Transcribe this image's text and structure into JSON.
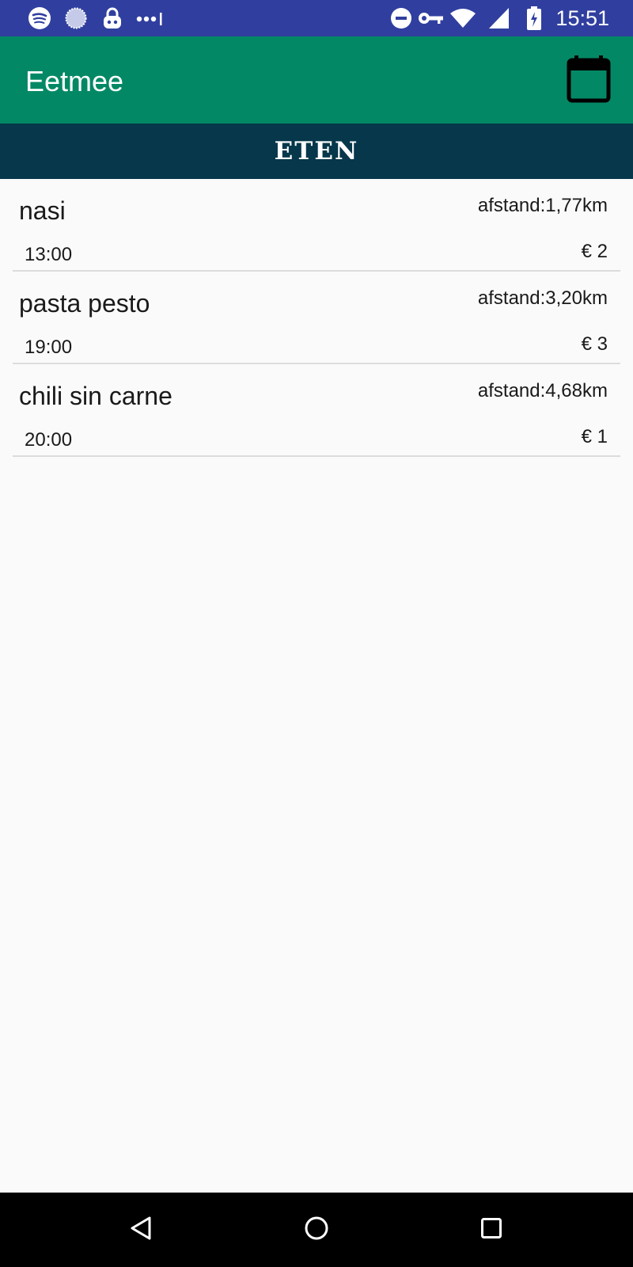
{
  "status_bar": {
    "time": "15:51",
    "left_icons": [
      "spotify-icon",
      "circle-app-icon",
      "vpn-lock-icon",
      "more-notifications-icon"
    ],
    "right_icons": [
      "do-not-disturb-icon",
      "vpn-key-icon",
      "wifi-icon",
      "cell-signal-icon",
      "battery-charging-icon"
    ]
  },
  "app_bar": {
    "title": "Eetmee",
    "calendar_icon": "calendar-icon",
    "color": "#038865"
  },
  "section": {
    "title": "ETEN",
    "color": "#06374a"
  },
  "meals": [
    {
      "name": "nasi",
      "distance": "afstand:1,77km",
      "time": "13:00",
      "price": "€ 2"
    },
    {
      "name": "pasta pesto",
      "distance": "afstand:3,20km",
      "time": "19:00",
      "price": "€ 3"
    },
    {
      "name": "chili sin carne",
      "distance": "afstand:4,68km",
      "time": "20:00",
      "price": "€ 1"
    }
  ],
  "nav_bar": {
    "buttons": [
      "back-icon",
      "home-icon",
      "recents-icon"
    ]
  },
  "colors": {
    "status_bar": "#303f9f",
    "background": "#fafafa",
    "nav_bar": "#000000"
  }
}
